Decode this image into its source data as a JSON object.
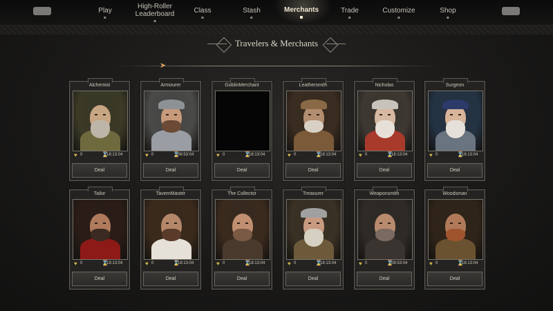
{
  "nav": {
    "left_button": "",
    "right_button": "",
    "items": [
      {
        "label": "Play",
        "active": false
      },
      {
        "label": "High-Roller\nLeaderboard",
        "active": false
      },
      {
        "label": "Class",
        "active": false
      },
      {
        "label": "Stash",
        "active": false
      },
      {
        "label": "Merchants",
        "active": true
      },
      {
        "label": "Trade",
        "active": false
      },
      {
        "label": "Customize",
        "active": false
      },
      {
        "label": "Shop",
        "active": false
      }
    ]
  },
  "header": {
    "title": "Travelers & Merchants"
  },
  "merchants": [
    {
      "name": "Alchemist",
      "affinity": "0",
      "time": "18:13:04",
      "deal": "Deal"
    },
    {
      "name": "Armourer",
      "affinity": "0",
      "time": "08:53:04",
      "deal": "Deal"
    },
    {
      "name": "GoblinMerchant",
      "affinity": "0",
      "time": "18:13:04",
      "deal": "Deal"
    },
    {
      "name": "Leathersmith",
      "affinity": "0",
      "time": "18:13:04",
      "deal": "Deal"
    },
    {
      "name": "Nicholas",
      "affinity": "0",
      "time": "18:13:04",
      "deal": "Deal"
    },
    {
      "name": "Surgeon",
      "affinity": "0",
      "time": "18:13:04",
      "deal": "Deal"
    },
    {
      "name": "Tailor",
      "affinity": "0",
      "time": "18:13:04",
      "deal": "Deal"
    },
    {
      "name": "TavernMaster",
      "affinity": "0",
      "time": "18:13:04",
      "deal": "Deal"
    },
    {
      "name": "The Collector",
      "affinity": "0",
      "time": "18:13:04",
      "deal": "Deal"
    },
    {
      "name": "Treasurer",
      "affinity": "0",
      "time": "18:13:04",
      "deal": "Deal"
    },
    {
      "name": "Weaponsmith",
      "affinity": "0",
      "time": "08:53:04",
      "deal": "Deal"
    },
    {
      "name": "Woodsman",
      "affinity": "0",
      "time": "18:13:04",
      "deal": "Deal"
    }
  ],
  "icons": {
    "affinity": "heart-icon",
    "timer": "hourglass-icon",
    "cursor": "arrow-cursor-icon"
  },
  "colors": {
    "accent": "#efe6cf",
    "gold": "#d4b84a"
  }
}
